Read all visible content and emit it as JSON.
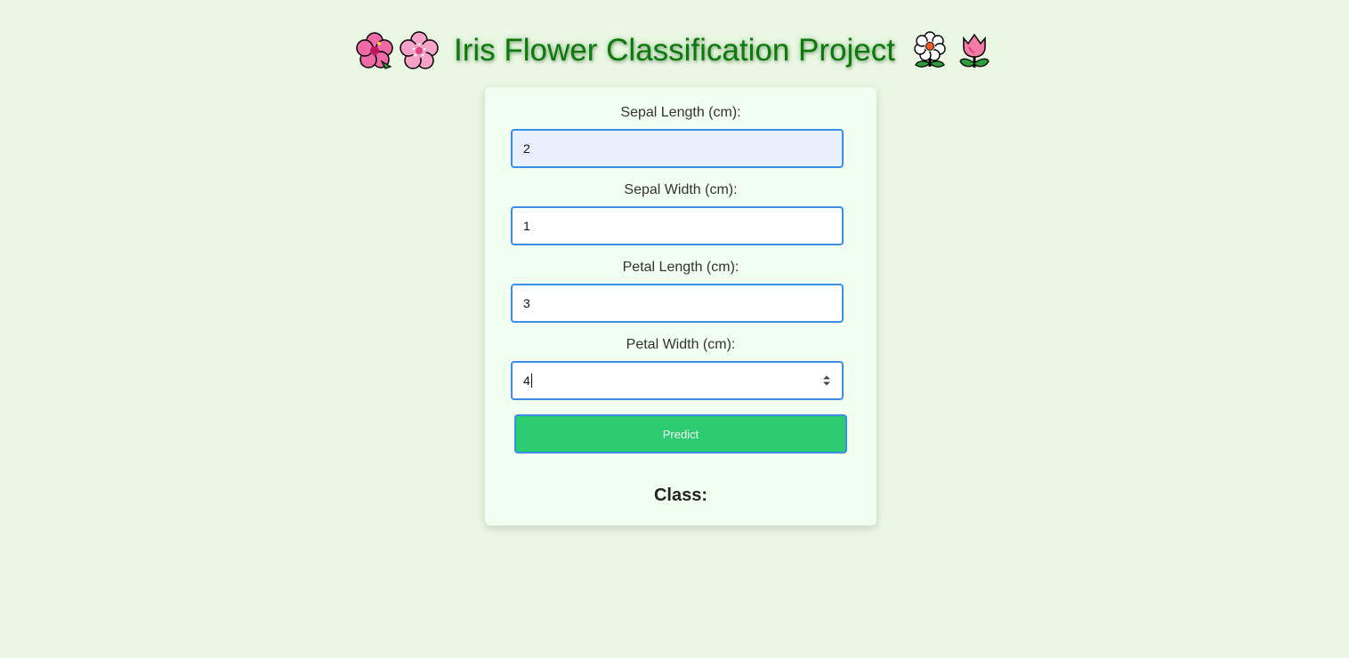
{
  "header": {
    "title": "Iris Flower Classification Project",
    "icons": [
      "hibiscus-icon",
      "cherry-blossom-icon",
      "blossom-icon",
      "tulip-icon"
    ]
  },
  "form": {
    "fields": [
      {
        "label": "Sepal Length (cm):",
        "value": "2"
      },
      {
        "label": "Sepal Width (cm):",
        "value": "1"
      },
      {
        "label": "Petal Length (cm):",
        "value": "3"
      },
      {
        "label": "Petal Width (cm):",
        "value": "4"
      }
    ],
    "predict_label": "Predict"
  },
  "result": {
    "label": "Class:"
  },
  "colors": {
    "background": "#eaf7e3",
    "card": "#f0fff0",
    "title": "#0b7a0b",
    "input_border": "#3a8ee6",
    "button": "#2ecc71"
  }
}
